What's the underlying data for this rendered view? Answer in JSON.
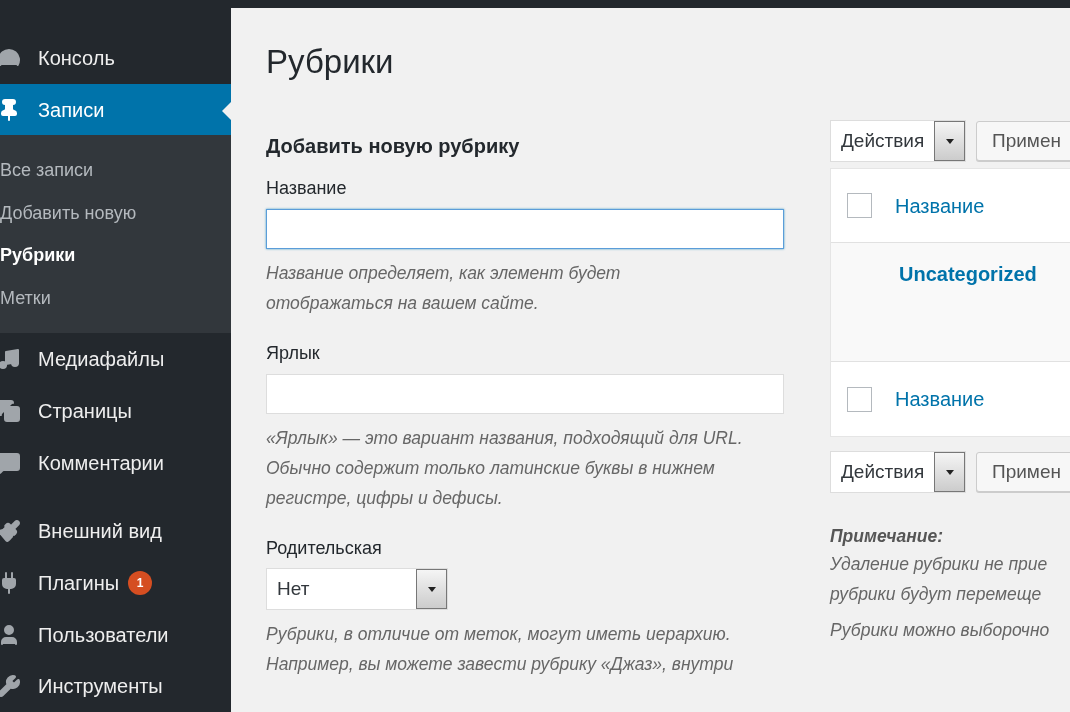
{
  "sidebar": {
    "items": [
      {
        "label": "Консоль",
        "selected": false
      },
      {
        "label": "Записи",
        "selected": true,
        "children": [
          {
            "label": "Все записи",
            "selected": false
          },
          {
            "label": "Добавить новую",
            "selected": false
          },
          {
            "label": "Рубрики",
            "selected": true
          },
          {
            "label": "Метки",
            "selected": false
          }
        ]
      },
      {
        "label": "Медиафайлы",
        "selected": false
      },
      {
        "label": "Страницы",
        "selected": false
      },
      {
        "label": "Комментарии",
        "selected": false
      },
      {
        "label": "Внешний вид",
        "selected": false
      },
      {
        "label": "Плагины",
        "selected": false,
        "badge": "1"
      },
      {
        "label": "Пользователи",
        "selected": false
      },
      {
        "label": "Инструменты",
        "selected": false
      }
    ]
  },
  "page_title": "Рубрики",
  "form": {
    "heading": "Добавить новую рубрику",
    "fields": [
      {
        "kind": "text",
        "label": "Название",
        "focused": true,
        "hint_lines": [
          "Название определяет, как элемент будет",
          "отображаться на вашем сайте."
        ]
      },
      {
        "kind": "text",
        "label": "Ярлык",
        "focused": false,
        "hint_lines": [
          "«Ярлык» — это вариант названия, подходящий для URL.",
          "Обычно содержит только латинские буквы в нижнем",
          "регистре, цифры и дефисы."
        ]
      },
      {
        "kind": "select",
        "label": "Родительская",
        "value": "Нет",
        "hint_lines": [
          "Рубрики, в отличие от меток, могут иметь иерархию.",
          "Например, вы можете завести рубрику «Джаз», внутри"
        ]
      }
    ]
  },
  "bulk_top": {
    "select": "Действия",
    "button": "Примен"
  },
  "table": {
    "header": {
      "checked": false,
      "label": "Название"
    },
    "rows": [
      {
        "name": "Uncategorized"
      }
    ],
    "footer": {
      "checked": false,
      "label": "Название"
    }
  },
  "bulk_bottom": {
    "select": "Действия",
    "button": "Примен"
  },
  "note": {
    "label": "Примечание:",
    "lines": [
      "Удаление рубрики не прие",
      "рубрики будут перемеще"
    ],
    "extra": "Рубрики можно выборочно"
  }
}
